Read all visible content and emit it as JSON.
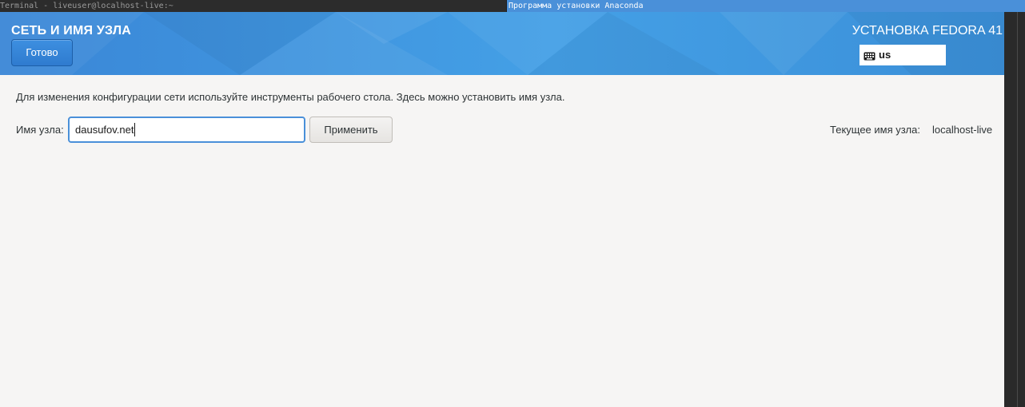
{
  "taskbar": {
    "terminal_title": "Terminal - liveuser@localhost-live:~",
    "anaconda_title": "Программа установки Anaconda"
  },
  "header": {
    "spoke_title": "СЕТЬ И ИМЯ УЗЛА",
    "done_label": "Готово",
    "product_title": "УСТАНОВКА FEDORA 41",
    "keyboard_layout": "us",
    "accent_color": "#3d8fe0"
  },
  "content": {
    "description": "Для изменения конфигурации сети используйте инструменты рабочего стола. Здесь можно установить имя узла.",
    "hostname_label": "Имя узла:",
    "hostname_value": "dausufov.net",
    "apply_label": "Применить",
    "current_hostname_label": "Текущее имя узла:",
    "current_hostname_value": "localhost-live"
  },
  "icons": {
    "keyboard": "keyboard-icon"
  }
}
